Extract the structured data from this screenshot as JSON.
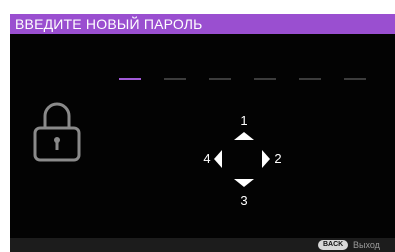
{
  "header": {
    "title": "ВВЕДИТЕ НОВЫЙ ПАРОЛЬ"
  },
  "password": {
    "total_digits": 6,
    "active_index": 0,
    "active_color": "#a25ad8",
    "inactive_color": "#3c3c3c"
  },
  "icons": {
    "lock": "lock-icon"
  },
  "keypad": {
    "up_label": "1",
    "right_label": "2",
    "down_label": "3",
    "left_label": "4"
  },
  "footer": {
    "back_label": "BACK",
    "exit_label": "Выход"
  },
  "colors": {
    "accent": "#9a4fd0",
    "background": "#030303"
  }
}
